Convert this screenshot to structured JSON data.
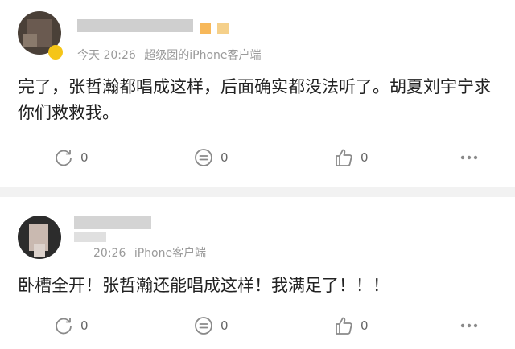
{
  "comments": [
    {
      "time": "今天 20:26",
      "source": "超级囡的iPhone客户端",
      "text": "完了，张哲瀚都唱成这样，后面确实都没法听了。胡夏刘宇宁求你们救救我。",
      "repost_count": "0",
      "comment_count": "0",
      "like_count": "0"
    },
    {
      "time": "20:26",
      "source": "iPhone客户端",
      "text": "卧槽全开！张哲瀚还能唱成这样！我满足了！！！",
      "repost_count": "0",
      "comment_count": "0",
      "like_count": "0"
    }
  ],
  "colors": {
    "background": "#f2f2f2",
    "card": "#ffffff",
    "meta_text": "#9a9a9a",
    "icon": "#8a8a8a"
  },
  "icons": [
    "repost-icon",
    "comment-icon",
    "like-icon",
    "more-icon"
  ]
}
